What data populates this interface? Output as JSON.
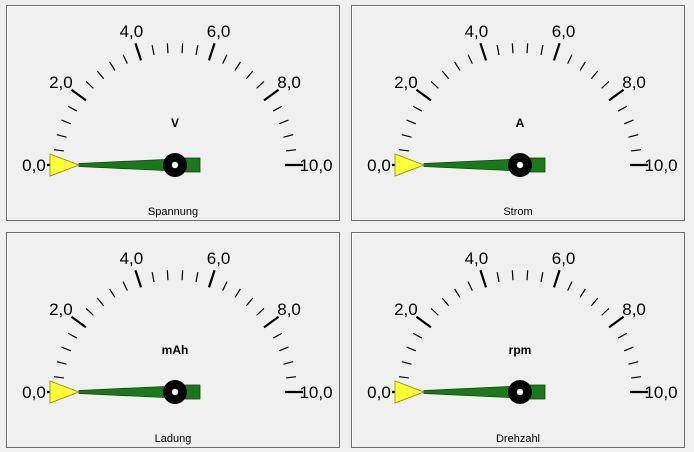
{
  "scale": {
    "min": 0,
    "max": 10,
    "labels": [
      "0,0",
      "2,0",
      "4,0",
      "6,0",
      "8,0",
      "10,0"
    ]
  },
  "colors": {
    "needle": "#1a7a1a",
    "pointer": "#ffff33",
    "ticks": "#000000",
    "panel_bg": "#f0f0f0"
  },
  "gauges": [
    {
      "unit": "V",
      "caption": "Spannung",
      "value": 0
    },
    {
      "unit": "A",
      "caption": "Strom",
      "value": 0
    },
    {
      "unit": "mAh",
      "caption": "Ladung",
      "value": 0
    },
    {
      "unit": "rpm",
      "caption": "Drehzahl",
      "value": 0
    }
  ]
}
